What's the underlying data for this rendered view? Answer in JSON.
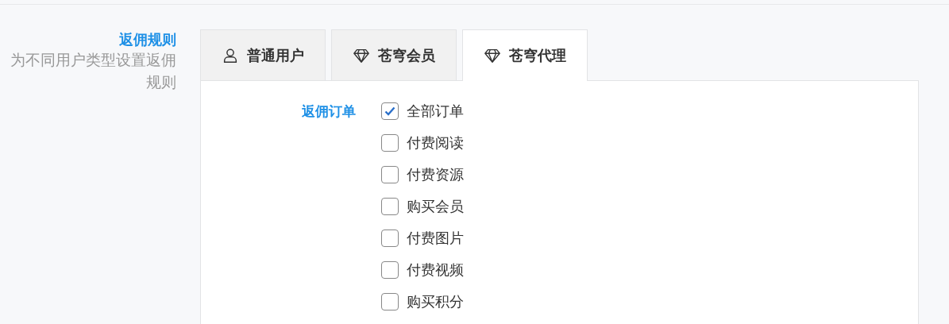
{
  "section": {
    "title": "返佣规则",
    "description": "为不同用户类型设置返佣规则"
  },
  "tabs": [
    {
      "label": "普通用户",
      "kind": "user",
      "selected": false
    },
    {
      "label": "苍穹会员",
      "kind": "diamond",
      "selected": false
    },
    {
      "label": "苍穹代理",
      "kind": "diamond",
      "selected": true
    }
  ],
  "field": {
    "label": "返佣订单",
    "options": [
      {
        "label": "全部订单",
        "checked": true
      },
      {
        "label": "付费阅读",
        "checked": false
      },
      {
        "label": "付费资源",
        "checked": false
      },
      {
        "label": "购买会员",
        "checked": false
      },
      {
        "label": "付费图片",
        "checked": false
      },
      {
        "label": "付费视频",
        "checked": false
      },
      {
        "label": "购买积分",
        "checked": false
      }
    ]
  }
}
